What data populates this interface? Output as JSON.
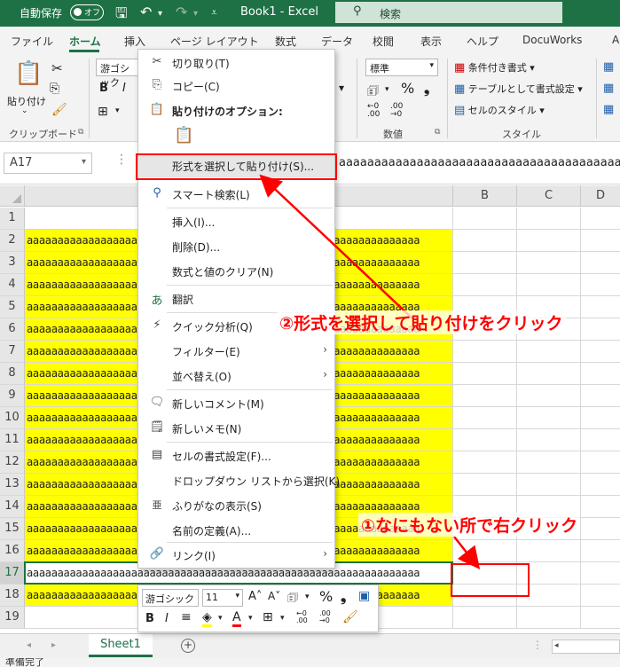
{
  "titlebar": {
    "autosave_label": "自動保存",
    "autosave_state": "オフ",
    "title": "Book1  -  Excel",
    "search_placeholder": "検索"
  },
  "tabs": [
    "ファイル",
    "ホーム",
    "挿入",
    "ページ レイアウト",
    "数式",
    "データ",
    "校閲",
    "表示",
    "ヘルプ",
    "DocuWorks",
    "A"
  ],
  "ribbon": {
    "paste_label": "貼り付け",
    "clipboard_group": "クリップボード",
    "font_name": "游ゴシック",
    "number_format": "標準",
    "number_group": "数値",
    "styles": {
      "conditional": "条件付き書式",
      "table": "テーブルとして書式設定",
      "cell_style": "セルのスタイル",
      "group": "スタイル"
    }
  },
  "formula_bar": {
    "name_box": "A17",
    "content": "aaaaaaaaaaaaaaaaaaaaaaaaaaaaaaaaaaaaaaaaaa"
  },
  "columns": [
    "B",
    "C",
    "D"
  ],
  "rows": [
    {
      "num": "1",
      "text": "",
      "yellow": false
    },
    {
      "num": "2",
      "text": "aaaaaaaaaaaaaaaaaaaaaaaaaaaaaaaaaaaaaaaaaaaaaaaaaaaaaaaaaaaaaaaa",
      "yellow": true
    },
    {
      "num": "3",
      "text": "aaaaaaaaaaaaaaaaaaaaaaaaaaaaaaaaaaaaaaaaaaaaaaaaaaaaaaaaaaaaaaaa",
      "yellow": true
    },
    {
      "num": "4",
      "text": "aaaaaaaaaaaaaaaaaaaaaaaaaaaaaaaaaaaaaaaaaaaaaaaaaaaaaaaaaaaaaaaa",
      "yellow": true
    },
    {
      "num": "5",
      "text": "aaaaaaaaaaaaaaaaaaaaaaaaaaaaaaaaaaaaaaaaaaaaaaaaaaaaaaaaaaaaaaaa",
      "yellow": true
    },
    {
      "num": "6",
      "text": "aaaaaaaaaaaaaaaaaaaaaaaaaaaaaaaaaaaaaaaaaaaaaaaaaaaaaaaaaaaaaaaa",
      "yellow": true
    },
    {
      "num": "7",
      "text": "aaaaaaaaaaaaaaaaaaaaaaaaaaaaaaaaaaaaaaaaaaaaaaaaaaaaaaaaaaaaaaaa",
      "yellow": true
    },
    {
      "num": "8",
      "text": "aaaaaaaaaaaaaaaaaaaaaaaaaaaaaaaaaaaaaaaaaaaaaaaaaaaaaaaaaaaaaaaa",
      "yellow": true
    },
    {
      "num": "9",
      "text": "aaaaaaaaaaaaaaaaaaaaaaaaaaaaaaaaaaaaaaaaaaaaaaaaaaaaaaaaaaaaaaaa",
      "yellow": true
    },
    {
      "num": "10",
      "text": "aaaaaaaaaaaaaaaaaaaaaaaaaaaaaaaaaaaaaaaaaaaaaaaaaaaaaaaaaaaaaaaa",
      "yellow": true
    },
    {
      "num": "11",
      "text": "aaaaaaaaaaaaaaaaaaaaaaaaaaaaaaaaaaaaaaaaaaaaaaaaaaaaaaaaaaaaaaaa",
      "yellow": true
    },
    {
      "num": "12",
      "text": "aaaaaaaaaaaaaaaaaaaaaaaaaaaaaaaaaaaaaaaaaaaaaaaaaaaaaaaaaaaaaaaa",
      "yellow": true
    },
    {
      "num": "13",
      "text": "aaaaaaaaaaaaaaaaaaaaaaaaaaaaaaaaaaaaaaaaaaaaaaaaaaaaaaaaaaaaaaaa",
      "yellow": true
    },
    {
      "num": "14",
      "text": "aaaaaaaaaaaaaaaaaaaaaaaaaaaaaaaaaaaaaaaaaaaaaaaaaaaaaaaaaaaaaaaa",
      "yellow": true
    },
    {
      "num": "15",
      "text": "aaaaaaaaaaaaaaaaaaaaaaaaaaaaaaaaaaaaaaaaaaaaaaaaaaaaaaaaaaaaaaaa",
      "yellow": true
    },
    {
      "num": "16",
      "text": "aaaaaaaaaaaaaaaaaaaaaaaaaaaaaaaaaaaaaaaaaaaaaaaaaaaaaaaaaaaaaaaa",
      "yellow": true
    },
    {
      "num": "17",
      "text": "aaaaaaaaaaaaaaaaaaaaaaaaaaaaaaaaaaaaaaaaaaaaaaaaaaaaaaaaaaaaaaaa",
      "yellow": false
    },
    {
      "num": "18",
      "text": "aaaaaaaaaaaaaaaaaaaaaaaaaaaaaaaaaaaaaaaaaaaaaaaaaaaaaaaaaaaaaaaa",
      "yellow": true
    },
    {
      "num": "19",
      "text": "",
      "yellow": false
    }
  ],
  "context_menu": {
    "cut": "切り取り(T)",
    "copy": "コピー(C)",
    "paste_options": "貼り付けのオプション:",
    "paste_special": "形式を選択して貼り付け(S)...",
    "smart_lookup": "スマート検索(L)",
    "insert": "挿入(I)...",
    "delete": "削除(D)...",
    "clear": "数式と値のクリア(N)",
    "translate": "翻訳",
    "quick_analysis": "クイック分析(Q)",
    "filter": "フィルター(E)",
    "sort": "並べ替え(O)",
    "new_comment": "新しいコメント(M)",
    "new_note": "新しいメモ(N)",
    "format_cells": "セルの書式設定(F)...",
    "dropdown_pick": "ドロップダウン リストから選択(K)...",
    "phonetic": "ふりがなの表示(S)",
    "define_name": "名前の定義(A)...",
    "link": "リンク(I)"
  },
  "mini_toolbar": {
    "font": "游ゴシック",
    "size": "11"
  },
  "sheet_tab": "Sheet1",
  "status": "準備完了",
  "annotations": {
    "step1": "①なにもない所で右クリック",
    "step2": "②形式を選択して貼り付けをクリック"
  },
  "colors": {
    "excel_green": "#1e7145",
    "highlight_yellow": "#ffff00",
    "annotation_red": "#ff0000"
  }
}
